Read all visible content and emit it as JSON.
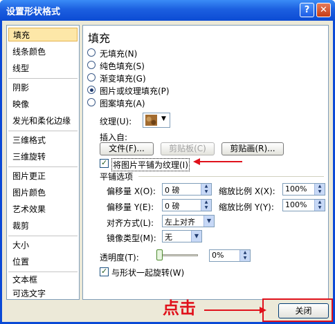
{
  "window": {
    "title": "设置形状格式",
    "help_label": "?",
    "close_label": "✕"
  },
  "sidebar": {
    "items": [
      {
        "label": "填充",
        "selected": true
      },
      {
        "label": "线条颜色"
      },
      {
        "label": "线型"
      },
      {
        "label": "阴影"
      },
      {
        "label": "映像"
      },
      {
        "label": "发光和柔化边缘"
      },
      {
        "label": "三维格式"
      },
      {
        "label": "三维旋转"
      },
      {
        "label": "图片更正"
      },
      {
        "label": "图片颜色"
      },
      {
        "label": "艺术效果"
      },
      {
        "label": "裁剪"
      },
      {
        "label": "大小"
      },
      {
        "label": "位置"
      },
      {
        "label": "文本框"
      },
      {
        "label": "可选文字"
      }
    ]
  },
  "fill": {
    "heading": "填充",
    "options": [
      {
        "label": "无填充(N)",
        "checked": false
      },
      {
        "label": "纯色填充(S)",
        "checked": false
      },
      {
        "label": "渐变填充(G)",
        "checked": false
      },
      {
        "label": "图片或纹理填充(P)",
        "checked": true
      },
      {
        "label": "图案填充(A)",
        "checked": false
      }
    ],
    "texture_label": "纹理(U):",
    "texture_icon": "wood-texture-icon",
    "insert_from_label": "插入自:",
    "file_button": "文件(F)...",
    "clipboard_button": "剪贴板(C)",
    "clipart_button": "剪贴画(R)...",
    "tile_checkbox": {
      "label": "将图片平铺为纹理(I)",
      "checked": true
    },
    "tile_options": {
      "heading": "平铺选项",
      "offset_x": {
        "label": "偏移量 X(O):",
        "value": "0 磅"
      },
      "offset_y": {
        "label": "偏移量 Y(E):",
        "value": "0 磅"
      },
      "scale_x": {
        "label": "缩放比例 X(X):",
        "value": "100%"
      },
      "scale_y": {
        "label": "缩放比例 Y(Y):",
        "value": "100%"
      },
      "alignment": {
        "label": "对齐方式(L):",
        "value": "左上对齐"
      },
      "mirror": {
        "label": "镜像类型(M):",
        "value": "无"
      }
    },
    "transparency": {
      "label": "透明度(T):",
      "value": "0%",
      "level": 0
    },
    "rotate_checkbox": {
      "label": "与形状一起旋转(W)",
      "checked": true
    }
  },
  "annotation": {
    "text": "点击",
    "color": "#e0111b"
  },
  "footer": {
    "close_button": "关闭"
  }
}
